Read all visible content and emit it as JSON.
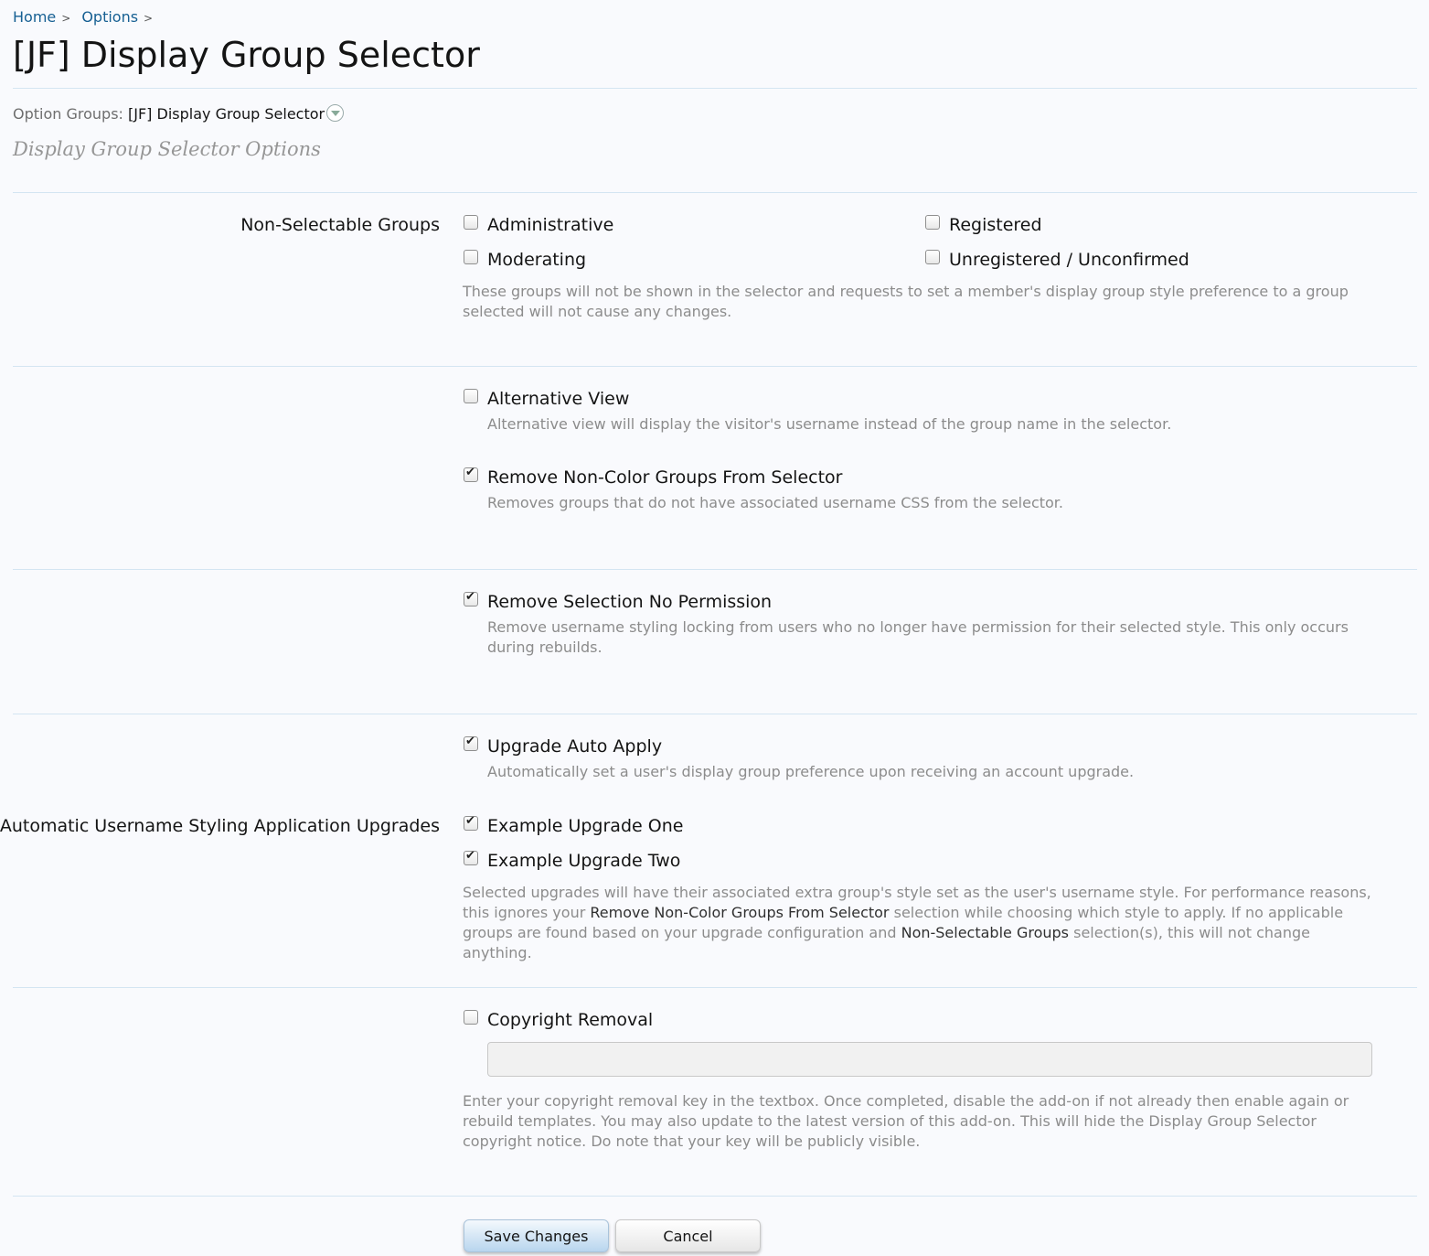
{
  "breadcrumb": {
    "items": [
      {
        "label": "Home"
      },
      {
        "label": "Options"
      }
    ],
    "separator": ">"
  },
  "page": {
    "title": "[JF] Display Group Selector",
    "option_groups_label": "Option Groups:",
    "option_groups_value": "[JF] Display Group Selector",
    "section_title": "Display Group Selector Options"
  },
  "non_selectable": {
    "label": "Non-Selectable Groups",
    "options": [
      {
        "label": "Administrative",
        "checked": false
      },
      {
        "label": "Registered",
        "checked": false
      },
      {
        "label": "Moderating",
        "checked": false
      },
      {
        "label": "Unregistered / Unconfirmed",
        "checked": false
      }
    ],
    "hint": "These groups will not be shown in the selector and requests to set a member's display group style preference to a group selected will not cause any changes."
  },
  "alt_view": {
    "label": "Alternative View",
    "checked": false,
    "hint": "Alternative view will display the visitor's username instead of the group name in the selector."
  },
  "remove_noncolor": {
    "label": "Remove Non-Color Groups From Selector",
    "checked": true,
    "hint": "Removes groups that do not have associated username CSS from the selector."
  },
  "remove_selection": {
    "label": "Remove Selection No Permission",
    "checked": true,
    "hint": "Remove username styling locking from users who no longer have permission for their selected style. This only occurs during rebuilds."
  },
  "upgrade_auto": {
    "label": "Upgrade Auto Apply",
    "checked": true,
    "hint": "Automatically set a user's display group preference upon receiving an account upgrade."
  },
  "upgrades": {
    "label": "Automatic Username Styling Application Upgrades",
    "options": [
      {
        "label": "Example Upgrade One",
        "checked": true
      },
      {
        "label": "Example Upgrade Two",
        "checked": true
      }
    ],
    "hint_parts": [
      "Selected upgrades will have their associated extra group's style set as the user's username style. For performance reasons, this ignores your ",
      "Remove Non-Color Groups From Selector",
      " selection while choosing which style to apply. If no applicable groups are found based on your upgrade configuration and ",
      "Non-Selectable Groups",
      " selection(s), this will not change anything."
    ]
  },
  "copyright": {
    "label": "Copyright Removal",
    "checked": false,
    "input_value": "",
    "hint": "Enter your copyright removal key in the textbox. Once completed, disable the add-on if not already then enable again or rebuild templates. You may also update to the latest version of this add-on. This will hide the Display Group Selector copyright notice. Do note that your key will be publicly visible."
  },
  "buttons": {
    "save": "Save Changes",
    "cancel": "Cancel"
  },
  "colors": {
    "link": "#176093",
    "divider": "#d4e5f2",
    "hint": "#8c8c8c",
    "background": "#f9fafd"
  }
}
